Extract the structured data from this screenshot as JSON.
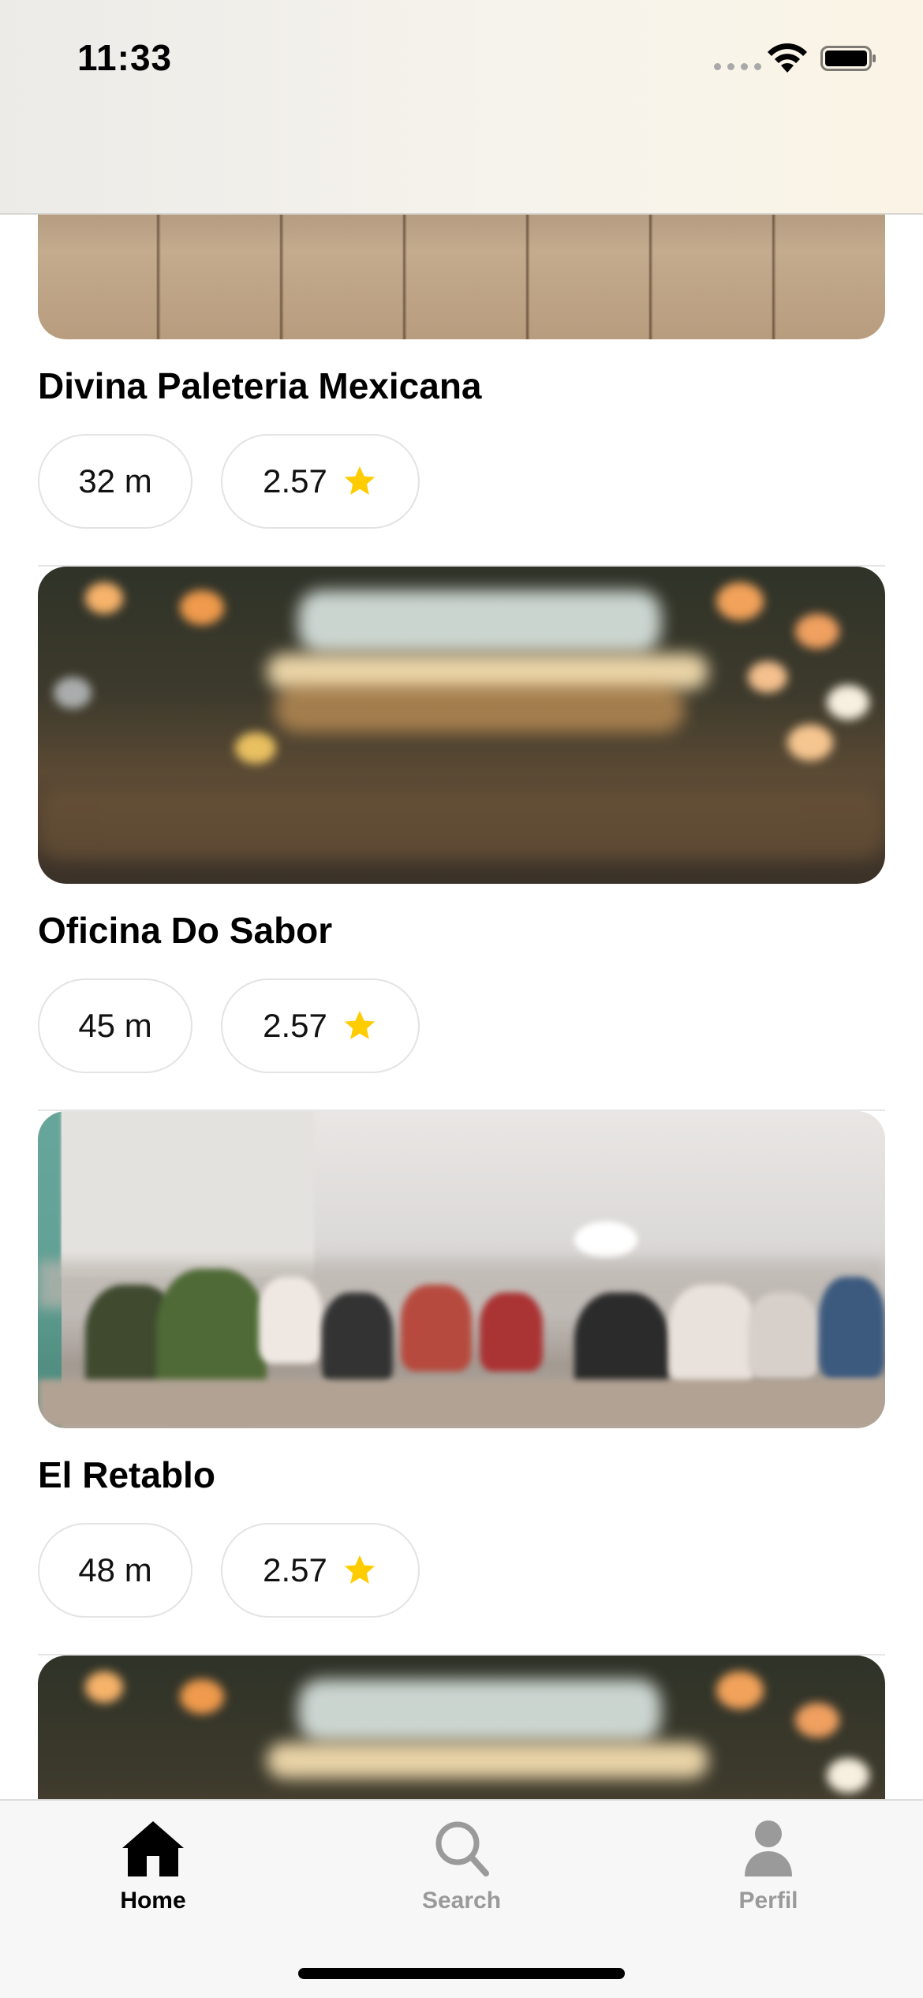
{
  "status_bar": {
    "time": "11:33"
  },
  "restaurants": [
    {
      "name": "Divina Paleteria Mexicana",
      "distance": "32 m",
      "rating": "2.57",
      "image": "wooden-table-photo"
    },
    {
      "name": "Oficina Do Sabor",
      "distance": "45 m",
      "rating": "2.57",
      "image": "bokeh-restaurant-photo"
    },
    {
      "name": "El Retablo",
      "distance": "48 m",
      "rating": "2.57",
      "image": "food-court-photo"
    },
    {
      "name": "",
      "distance": "",
      "rating": "",
      "image": "bokeh-restaurant-photo"
    }
  ],
  "tab_bar": {
    "items": [
      {
        "label": "Home",
        "icon": "home-icon",
        "active": true
      },
      {
        "label": "Search",
        "icon": "search-icon",
        "active": false
      },
      {
        "label": "Perfil",
        "icon": "person-icon",
        "active": false
      }
    ]
  },
  "colors": {
    "star": "#FFCC00",
    "active_tab": "#000000",
    "inactive_tab": "#9A9A9A"
  }
}
